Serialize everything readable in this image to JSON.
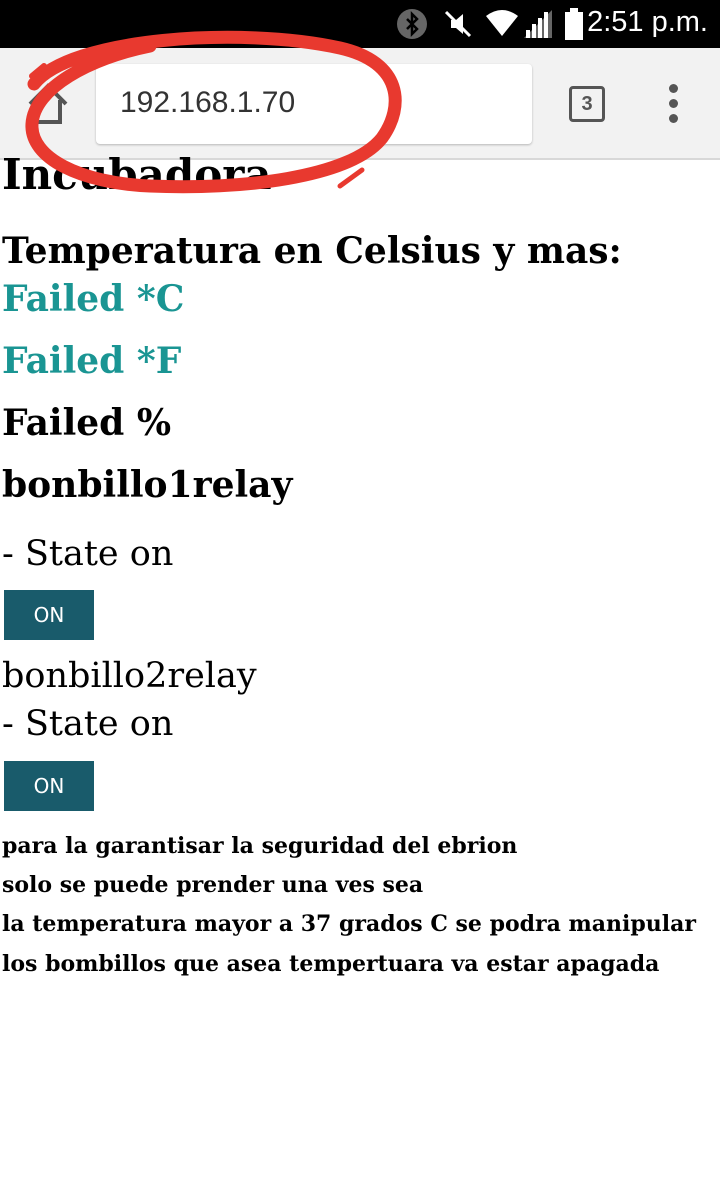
{
  "status_bar": {
    "time": "2:51 p.m.",
    "icons": [
      "bluetooth-icon",
      "mute-icon",
      "wifi-icon",
      "signal-icon",
      "battery-icon"
    ]
  },
  "browser": {
    "url": "192.168.1.70",
    "tab_count": "3",
    "icons": [
      "home-icon",
      "tab-switcher-icon",
      "overflow-menu-icon"
    ]
  },
  "page": {
    "title": "Incubadora",
    "temperature_heading": "Temperatura en Celsius y mas:",
    "celsius_reading": "Failed *C",
    "fahrenheit_reading": "Failed *F",
    "humidity_reading": "Failed %",
    "relay1": {
      "title": "bonbillo1relay",
      "state": "- State on",
      "button_label": "ON"
    },
    "relay2": {
      "title": "bonbillo2relay",
      "state": "- State on",
      "button_label": "ON"
    },
    "notes": [
      "para la garantisar la seguridad del ebrion",
      "solo se puede prender una ves sea",
      "la temperatura mayor a 37 grados C se podra manipular",
      "los bombillos que asea tempertuara va estar apagada"
    ]
  },
  "colors": {
    "reading_teal": "#1a9593",
    "button_bg": "#195b6b",
    "annotation_red": "#e8392f"
  }
}
